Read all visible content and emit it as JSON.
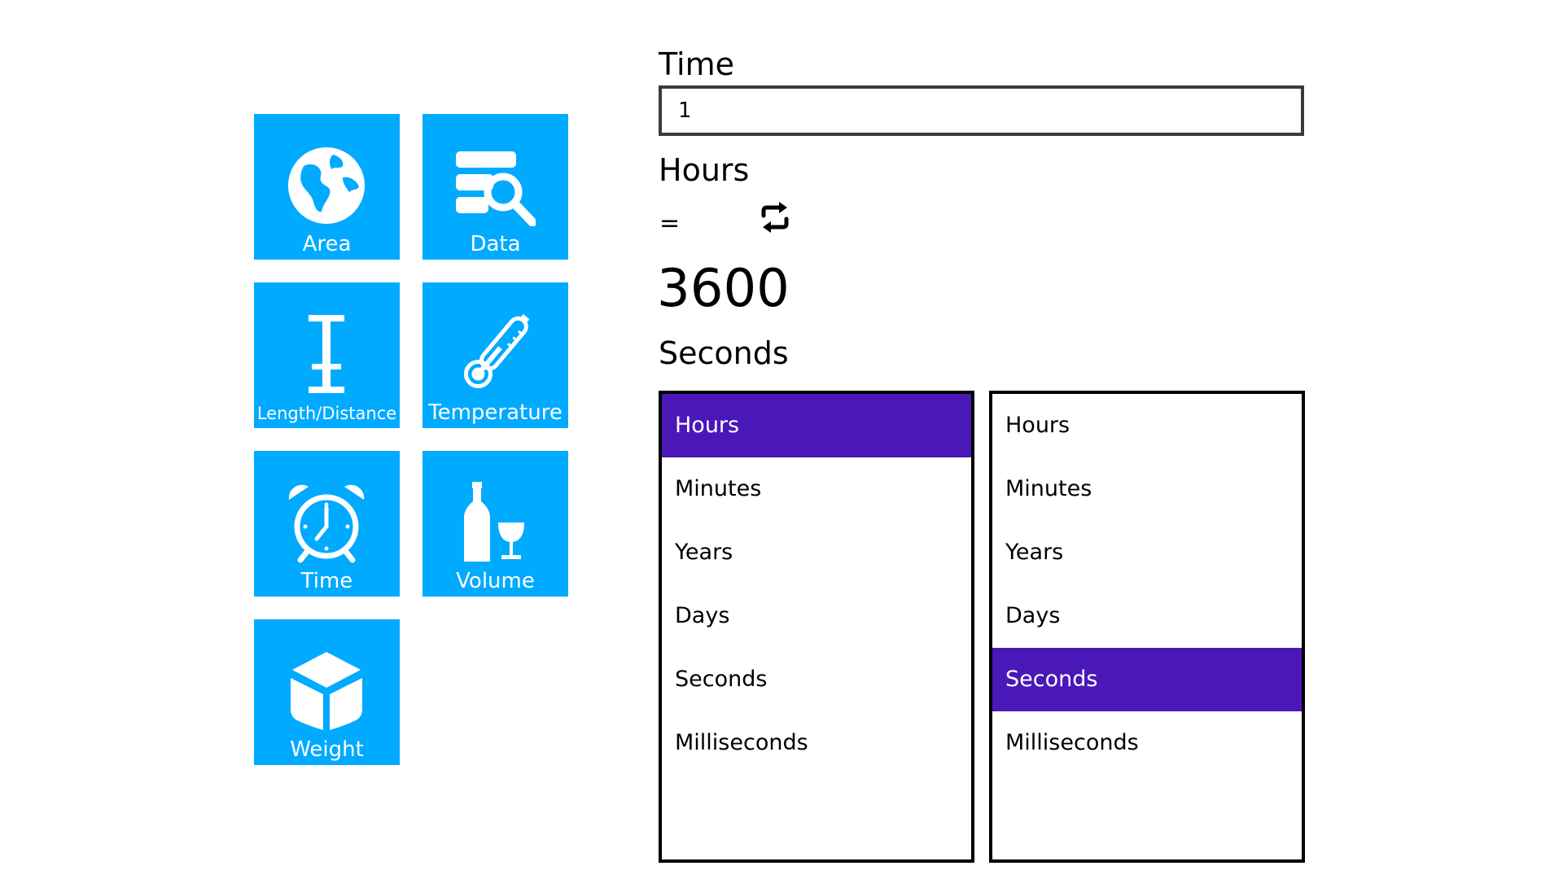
{
  "tiles": {
    "area": "Area",
    "data": "Data",
    "length": "Length/Distance",
    "temperature": "Temperature",
    "time": "Time",
    "volume": "Volume",
    "weight": "Weight"
  },
  "converter": {
    "category": "Time",
    "input_value": "1",
    "from_unit": "Hours",
    "equals": "=",
    "result": "3600",
    "to_unit": "Seconds"
  },
  "from_list": {
    "items": [
      "Hours",
      "Minutes",
      "Years",
      "Days",
      "Seconds",
      "Milliseconds"
    ],
    "selected": "Hours"
  },
  "to_list": {
    "items": [
      "Hours",
      "Minutes",
      "Years",
      "Days",
      "Seconds",
      "Milliseconds"
    ],
    "selected": "Seconds"
  },
  "colors": {
    "tile": "#00aaff",
    "selection": "#4a17b8"
  },
  "icons": {
    "swap": "swap-arrows-icon"
  }
}
